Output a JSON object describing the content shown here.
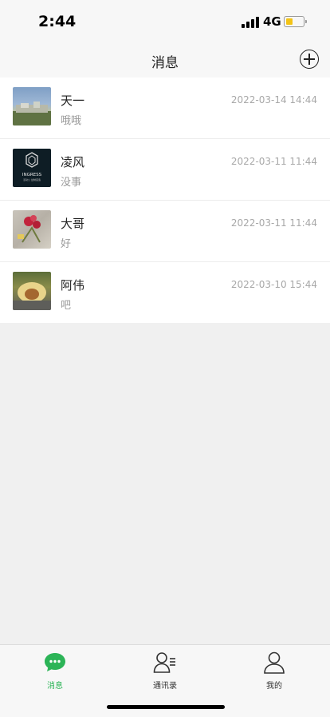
{
  "status_bar": {
    "time": "2:44",
    "network": "4G"
  },
  "nav": {
    "title": "消息"
  },
  "conversations": [
    {
      "name": "天一",
      "preview": "哦哦",
      "time": "2022-03-14 14:44"
    },
    {
      "name": "凌风",
      "preview": "没事",
      "time": "2022-03-11 11:44"
    },
    {
      "name": "大哥",
      "preview": "好",
      "time": "2022-03-11 11:44"
    },
    {
      "name": "阿伟",
      "preview": "吧",
      "time": "2022-03-10 15:44"
    }
  ],
  "avatar2": {
    "line1": "INGRESS",
    "line2": "活动公 益制度造"
  },
  "tabs": [
    {
      "label": "消息",
      "icon": "chat-bubble-icon",
      "active": true
    },
    {
      "label": "通讯录",
      "icon": "contacts-icon",
      "active": false
    },
    {
      "label": "我的",
      "icon": "user-icon",
      "active": false
    }
  ],
  "colors": {
    "active_tab": "#2cb457",
    "inactive_tab": "#333333",
    "battery": "#f3c316"
  }
}
